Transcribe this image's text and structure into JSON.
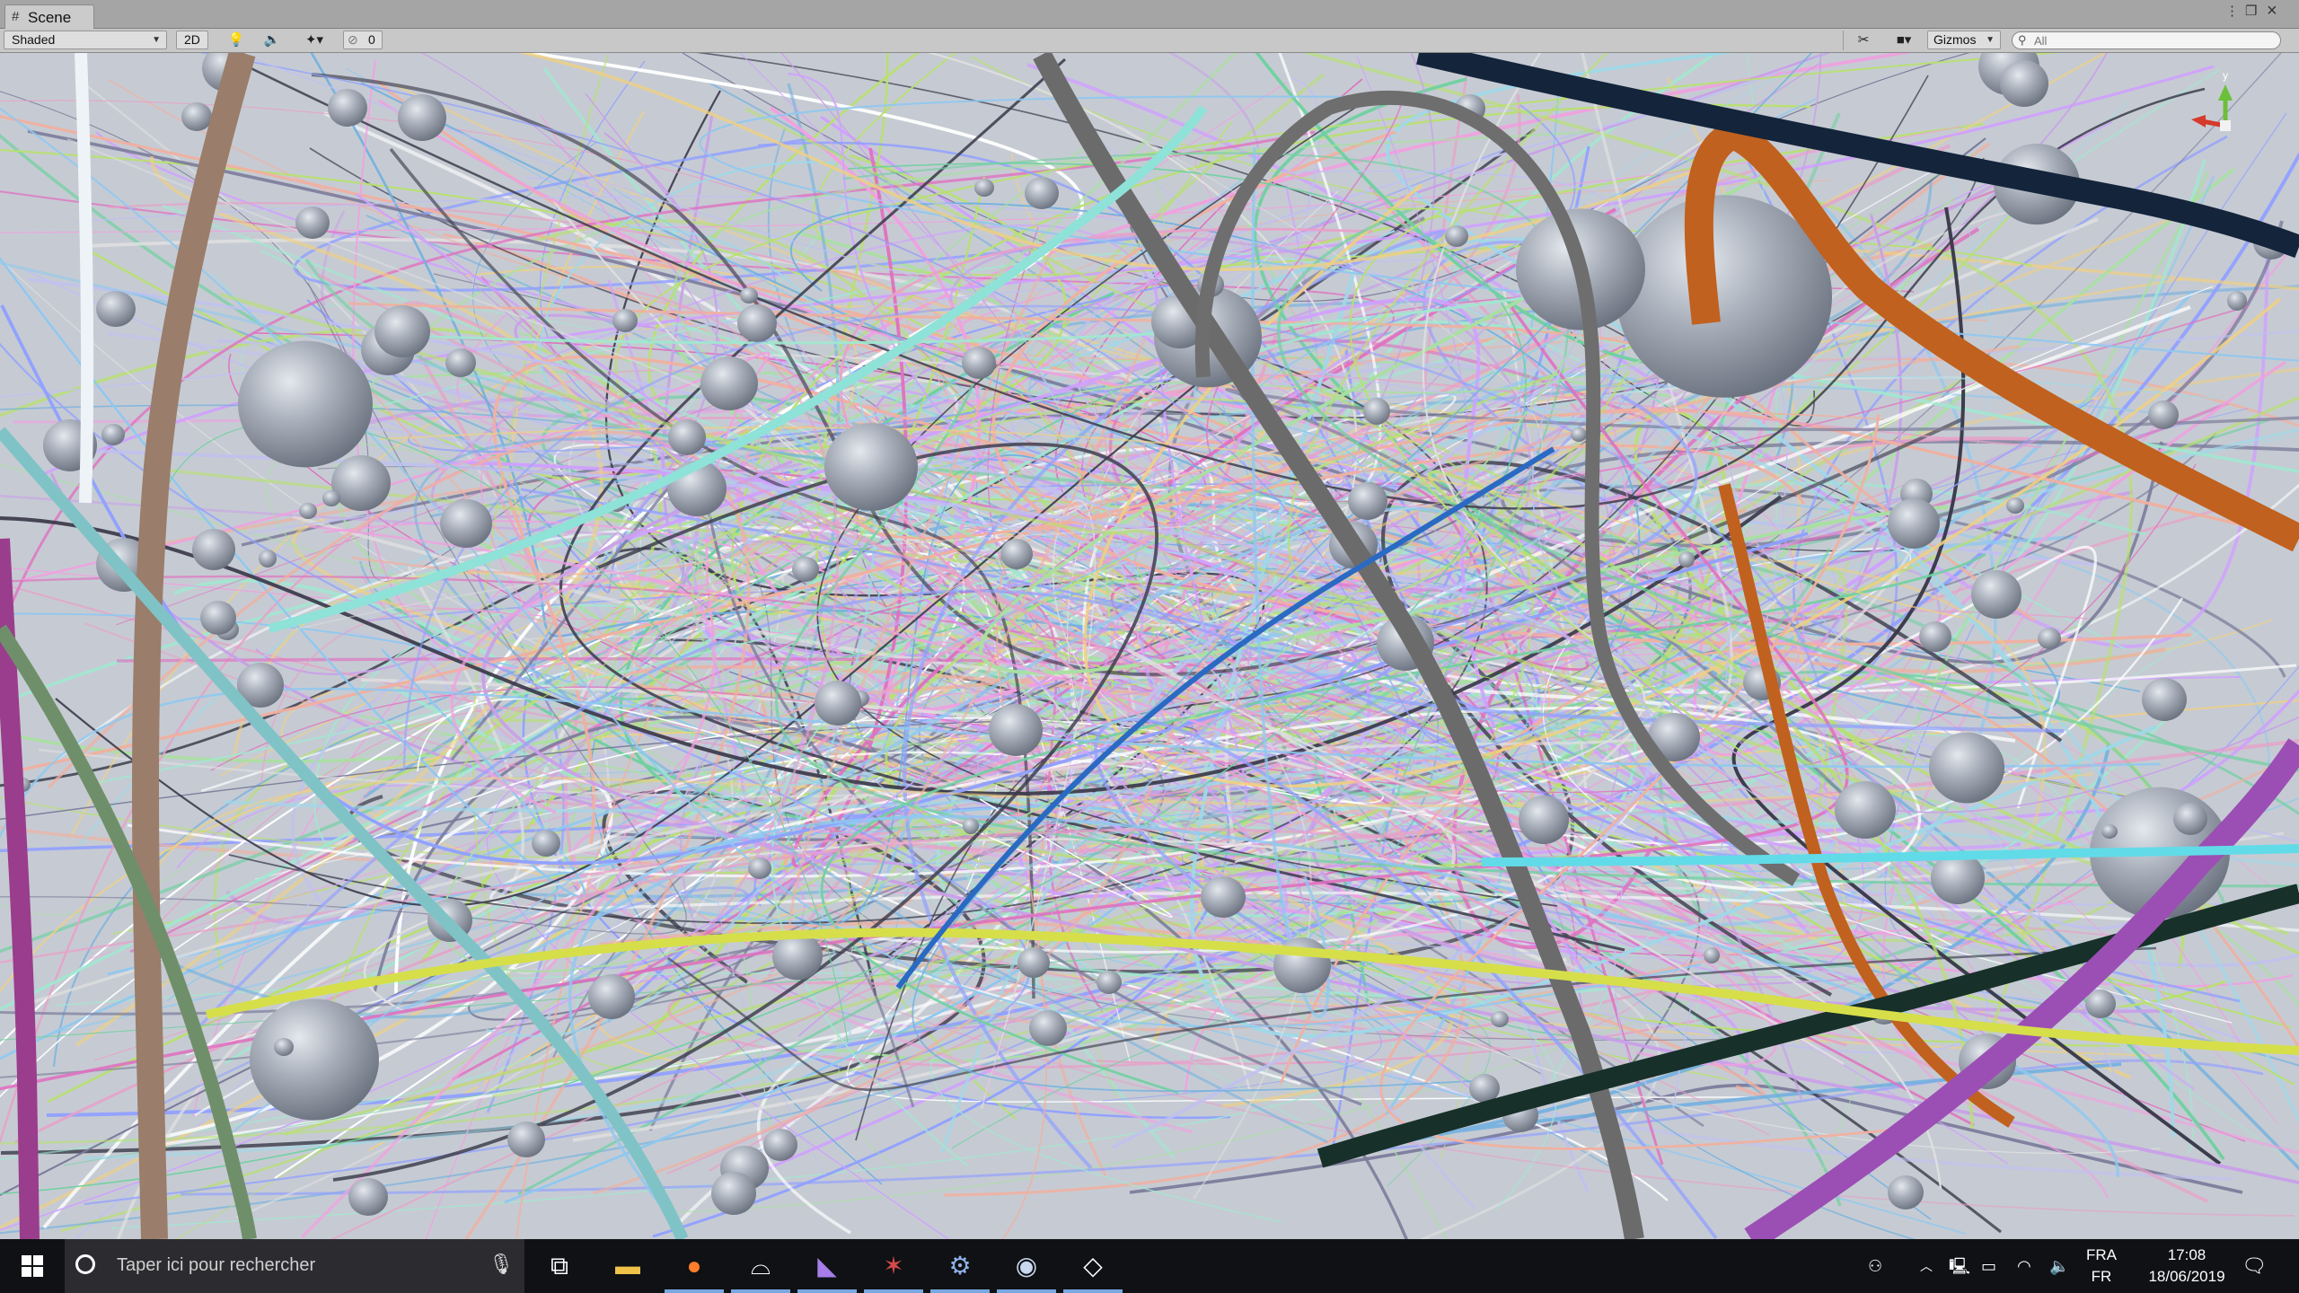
{
  "window": {
    "tab_icon": "grid-hash-icon",
    "tab_label": "Scene",
    "controls": [
      "window-menu-icon",
      "maximize-icon",
      "close-icon"
    ]
  },
  "toolbar": {
    "draw_mode": "Shaded",
    "mode_2d": "2D",
    "lighting_icon": "lightbulb-icon",
    "audio_icon": "speaker-icon",
    "effects_icon": "effects-icon",
    "hidden_count": "0",
    "tools_icon": "tools-icon",
    "camera_icon": "camera-icon",
    "gizmos": "Gizmos",
    "search_placeholder": "All"
  },
  "scene": {
    "gizmo_axis_label": "y",
    "background_color": "#c6cbd3",
    "sphere_color": "#a8afba"
  },
  "taskbar": {
    "start_icon": "windows-logo-icon",
    "search_placeholder": "Taper ici pour rechercher",
    "mic_icon": "microphone-icon",
    "apps": [
      {
        "name": "task-view-icon"
      },
      {
        "name": "file-explorer-icon"
      },
      {
        "name": "firefox-icon"
      },
      {
        "name": "vr-headset-icon"
      },
      {
        "name": "visual-studio-icon"
      },
      {
        "name": "game-engine-icon"
      },
      {
        "name": "settings-gear-icon"
      },
      {
        "name": "vr-app-icon"
      },
      {
        "name": "unity-icon"
      }
    ],
    "tray": {
      "language_line1": "FRA",
      "language_line2": "FR",
      "time": "17:08",
      "date": "18/06/2019"
    }
  }
}
